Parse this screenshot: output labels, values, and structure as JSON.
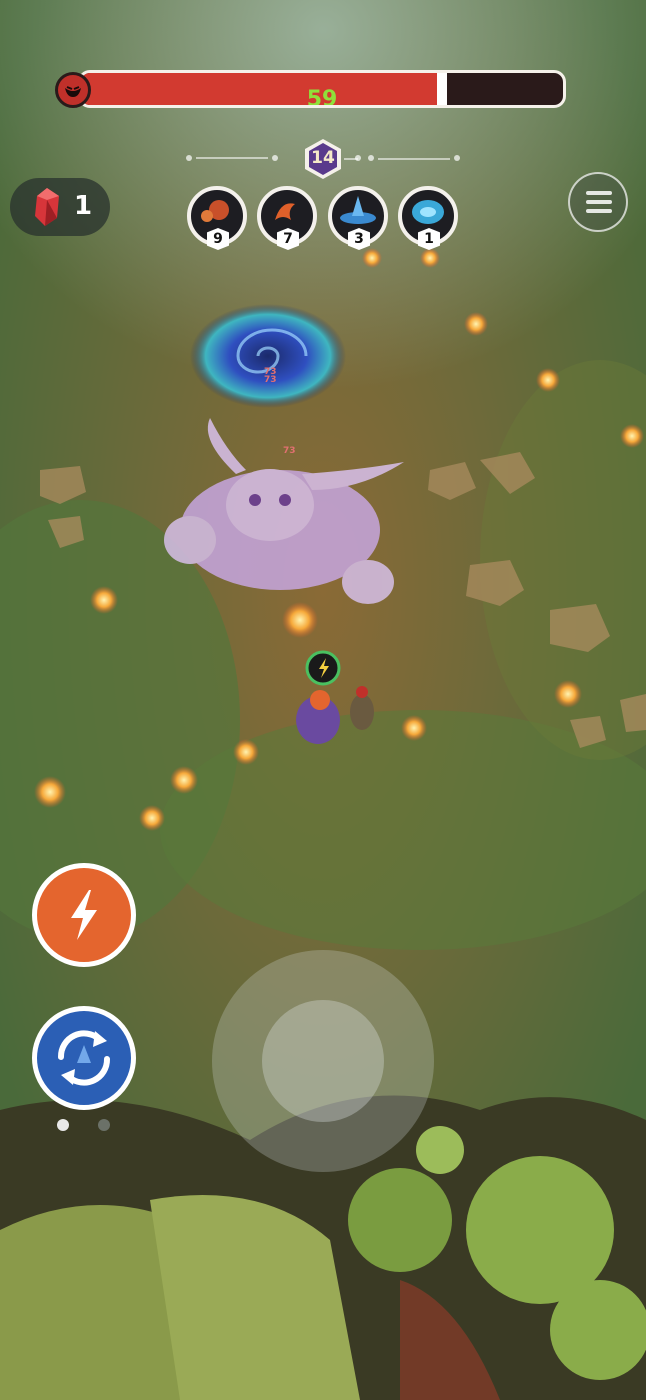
{
  "boss": {
    "hp_text": "59",
    "hp_fraction": 0.76
  },
  "wave": {
    "level": "14"
  },
  "resources": {
    "crystals": "1"
  },
  "skills": [
    {
      "icon": "fire-burst-skill-icon",
      "level": "9"
    },
    {
      "icon": "flame-spin-skill-icon",
      "level": "7"
    },
    {
      "icon": "water-tornado-skill-icon",
      "level": "3"
    },
    {
      "icon": "ice-vortex-skill-icon",
      "level": "1"
    }
  ],
  "damage_numbers": [
    "73",
    "73",
    "73"
  ],
  "controls": {
    "dash_icon": "lightning-bolt-icon",
    "swap_icon": "swap-arrows-icon"
  },
  "colors": {
    "hp_bar": "#d23a30",
    "hp_text": "#8fe03a",
    "dash": "#e4652e",
    "swap": "#2b5fb5",
    "level_badge": "#5a3a8c"
  }
}
